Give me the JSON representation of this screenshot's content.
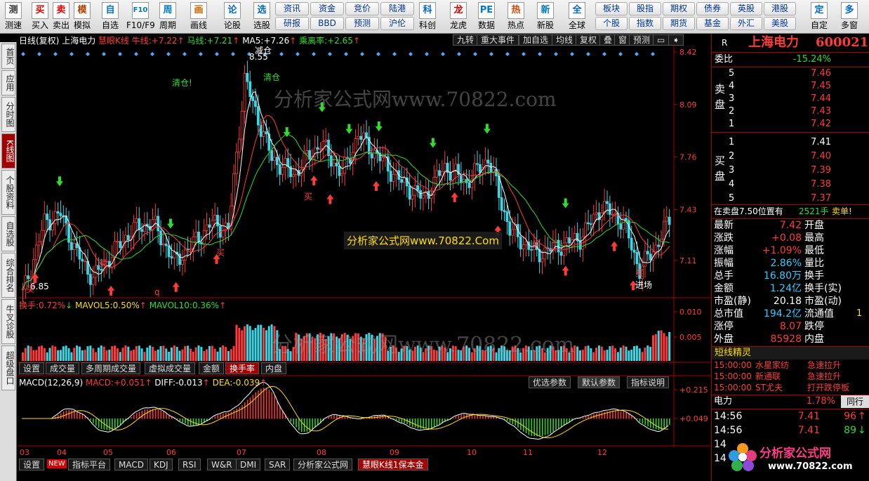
{
  "toolbar": {
    "buttons": [
      "测速",
      "买入",
      "卖出",
      "模拟",
      "自选",
      "F10/F9",
      "周期",
      "画线",
      "论股",
      "选股",
      "科创",
      "龙虎",
      "数据",
      "热点",
      "新股",
      "全球",
      "自定",
      "多窗"
    ],
    "icons": [
      "测",
      "买",
      "卖",
      "模",
      "自",
      "F10",
      "周",
      "画",
      "论",
      "选",
      "科",
      "龙",
      "PE",
      "热",
      "新",
      "全",
      "定",
      "多"
    ],
    "grid1": [
      "资讯",
      "资金",
      "竞价",
      "陆港",
      "研报",
      "BBD",
      "预测",
      "沪伦"
    ],
    "grid2": [
      "板块",
      "股指",
      "期权",
      "债券",
      "英股",
      "港股",
      "个股",
      "指数",
      "期货",
      "基金",
      "外汇",
      "美股"
    ]
  },
  "sidebar": [
    "首页",
    "应用",
    "分时图",
    "K线图",
    "个股资料",
    "自选股",
    "综合排名",
    "牛叉诊股",
    "超级盘口"
  ],
  "chart_header": {
    "mode": "日线(复权)",
    "stock": "上海电力",
    "ind_name": "慧眼K线",
    "l1": "牛线:",
    "v1": "+7.22",
    "l2": "马线:",
    "v2": "+7.21",
    "l3": "MA5:",
    "v3": "+7.26",
    "l4": "乘离率:",
    "v4": "+2.65"
  },
  "chart_buttons": [
    "九转",
    "重大事件",
    "加自选",
    "均线",
    "复权",
    "叠",
    "窗",
    "预测"
  ],
  "price_axis": [
    "8.42",
    "8.09",
    "7.76",
    "7.43",
    "7.11"
  ],
  "annotations": {
    "high": "8.55",
    "low": "6.85",
    "qc1": "清仓!",
    "qc2": "清仓",
    "qc3": "减仓",
    "buy": "买",
    "entry": "进场",
    "q": "q"
  },
  "vol_header": {
    "l1": "换手:",
    "v1": "0.72%",
    "l2": "MAVOL5:",
    "v2": "0.50%",
    "l3": "MAVOL10:",
    "v3": "0.36%"
  },
  "vol_axis": [
    "0.010",
    "0.005"
  ],
  "vol_tabs": [
    "设置",
    "成交量",
    "多周期成交量",
    "虚拟成交量",
    "金额",
    "换手率",
    "内盘"
  ],
  "macd_header": {
    "l1": "MACD(12,26,9)",
    "l2": "MACD:",
    "v2": "+0.051",
    "l3": "DIFF:",
    "v3": "-0.013",
    "l4": "DEA:",
    "v4": "-0.039"
  },
  "macd_buttons": [
    "优选参数",
    "默认参数",
    "指标说明"
  ],
  "macd_axis": [
    "+0.215",
    "+0.049"
  ],
  "date_axis": [
    "03",
    "04",
    "05",
    "06",
    "07",
    "08",
    "09",
    "10",
    "11",
    "12"
  ],
  "bottom_tabs": [
    "设置",
    "指标平台",
    "MACD",
    "KDJ",
    "RSI",
    "W&R",
    "DMI",
    "SAR",
    "分析家公式网",
    "慧眼K线1保本金"
  ],
  "new_badge": "NEW",
  "watermarks": [
    "分析家公式网www.70822.com",
    "分析家公式网www.70822.Com",
    "分析家公式网www.70822.com"
  ],
  "quote": {
    "r": "R",
    "name": "上海电力",
    "code": "600021",
    "weibi_label": "委比",
    "weibi": "-15.24%",
    "sell_label": "卖盘",
    "buy_label": "买盘",
    "sell": [
      {
        "n": "5",
        "p": "7.46"
      },
      {
        "n": "4",
        "p": "7.45"
      },
      {
        "n": "3",
        "p": "7.44"
      },
      {
        "n": "2",
        "p": "7.43"
      },
      {
        "n": "1",
        "p": "7.42"
      }
    ],
    "buy": [
      {
        "n": "1",
        "p": "7.41"
      },
      {
        "n": "2",
        "p": "7.40"
      },
      {
        "n": "3",
        "p": "7.39"
      },
      {
        "n": "4",
        "p": "7.38"
      },
      {
        "n": "5",
        "p": "7.37"
      }
    ],
    "note_a": "在卖盘7.50位置有",
    "note_b": "2521手",
    "note_c": "卖单!",
    "stats": [
      {
        "l": "最新",
        "v": "7.42",
        "r": "开盘"
      },
      {
        "l": "涨跌",
        "v": "+0.08",
        "r": "最高"
      },
      {
        "l": "涨幅",
        "v": "+1.09%",
        "r": "最低"
      },
      {
        "l": "振幅",
        "v": "2.86%",
        "r": "量比"
      },
      {
        "l": "总手",
        "v": "16.80万",
        "r": "换手"
      },
      {
        "l": "金额",
        "v": "1.24亿",
        "r": "换手(实)"
      },
      {
        "l": "市盈(静)",
        "v": "20.18",
        "r": "市盈(动)"
      },
      {
        "l": "总市值",
        "v": "194.2亿",
        "r": "流通值"
      },
      {
        "l": "涨停",
        "v": "8.07",
        "r": "跌停"
      },
      {
        "l": "外盘",
        "v": "85928",
        "r": "内盘"
      }
    ],
    "liutong_tail": "1",
    "elf_title": "短线精灵",
    "elf": [
      {
        "t": "15:00:00",
        "n": "水星家纺",
        "s": "急速拉升"
      },
      {
        "t": "15:00:00",
        "n": "新通联",
        "s": "急速拉升"
      },
      {
        "t": "15:00:00",
        "n": "ST尤夫",
        "s": "打开跌停板"
      }
    ],
    "sector": "电力",
    "sector_pct": "1.78%",
    "tongxing": "同行",
    "ticks": [
      {
        "t": "14:56",
        "p": "7.41",
        "v": "96"
      },
      {
        "t": "14:56",
        "p": "7.41",
        "v": "89"
      },
      {
        "t": "14:56",
        "p": "",
        "v": ""
      },
      {
        "t": "14:56",
        "p": "",
        "v": ""
      }
    ],
    "logo_text": "分析家公式网",
    "logo_url": "www.70822.com"
  },
  "colors": {
    "up": "#ff3a3a",
    "down": "#3ad7e6",
    "bg": "#000000",
    "accent": "#a30000"
  }
}
